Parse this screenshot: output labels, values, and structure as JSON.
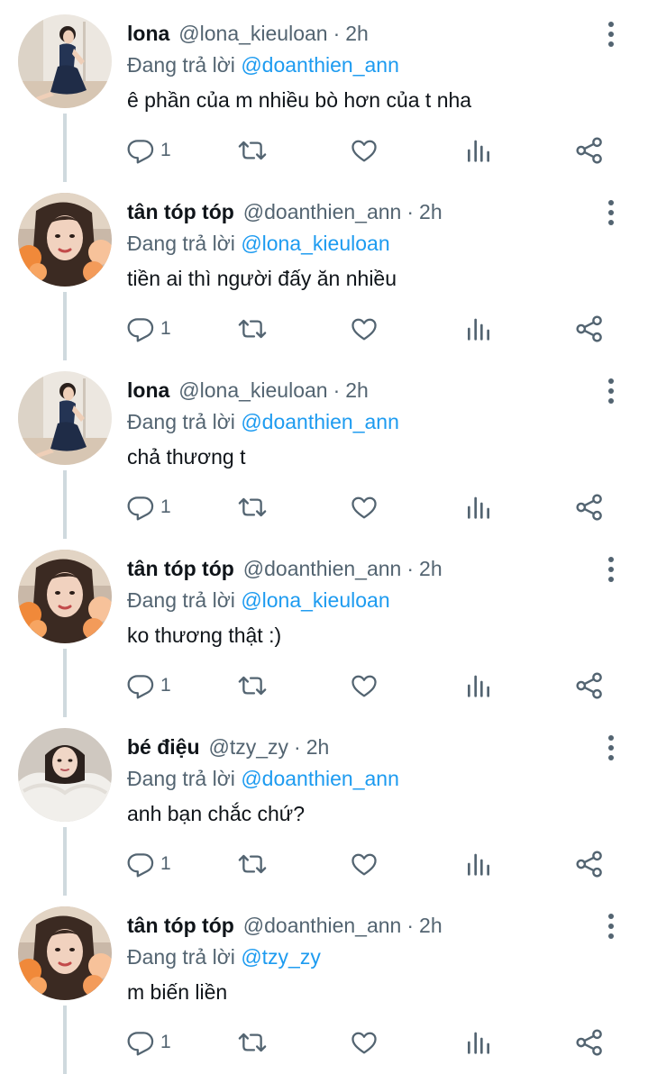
{
  "reply_prefix": "Đang trả lời",
  "tweets": [
    {
      "name": "lona",
      "handle": "@lona_kieuloan",
      "dot": "·",
      "time": "2h",
      "reply_to": "@doanthien_ann",
      "text": "ê phần của m nhiều bò hơn của t nha",
      "reply_count": "1",
      "avatar": "avatar-lona"
    },
    {
      "name": "tân tóp tóp",
      "handle": "@doanthien_ann",
      "dot": "·",
      "time": "2h",
      "reply_to": "@lona_kieuloan",
      "text": "tiền ai thì người đấy ăn nhiều",
      "reply_count": "1",
      "avatar": "avatar-tan"
    },
    {
      "name": "lona",
      "handle": "@lona_kieuloan",
      "dot": "·",
      "time": "2h",
      "reply_to": "@doanthien_ann",
      "text": "chả thương t",
      "reply_count": "1",
      "avatar": "avatar-lona"
    },
    {
      "name": "tân tóp tóp",
      "handle": "@doanthien_ann",
      "dot": "·",
      "time": "2h",
      "reply_to": "@lona_kieuloan",
      "text": "ko thương thật :)",
      "reply_count": "1",
      "avatar": "avatar-tan"
    },
    {
      "name": "bé điệu",
      "handle": "@tzy_zy",
      "dot": "·",
      "time": "2h",
      "reply_to": "@doanthien_ann",
      "text": "anh bạn chắc chứ?",
      "reply_count": "1",
      "avatar": "avatar-be-dieu"
    },
    {
      "name": "tân tóp tóp",
      "handle": "@doanthien_ann",
      "dot": "·",
      "time": "2h",
      "reply_to": "@tzy_zy",
      "text": "m biến liền",
      "reply_count": "1",
      "avatar": "avatar-tan"
    }
  ],
  "colors": {
    "accent": "#1d9bf0",
    "secondary_text": "#536471",
    "primary_text": "#0f1419",
    "thread_line": "#cfd9de"
  },
  "icons": [
    "reply-icon",
    "retweet-icon",
    "like-icon",
    "views-icon",
    "share-icon",
    "more-icon"
  ]
}
